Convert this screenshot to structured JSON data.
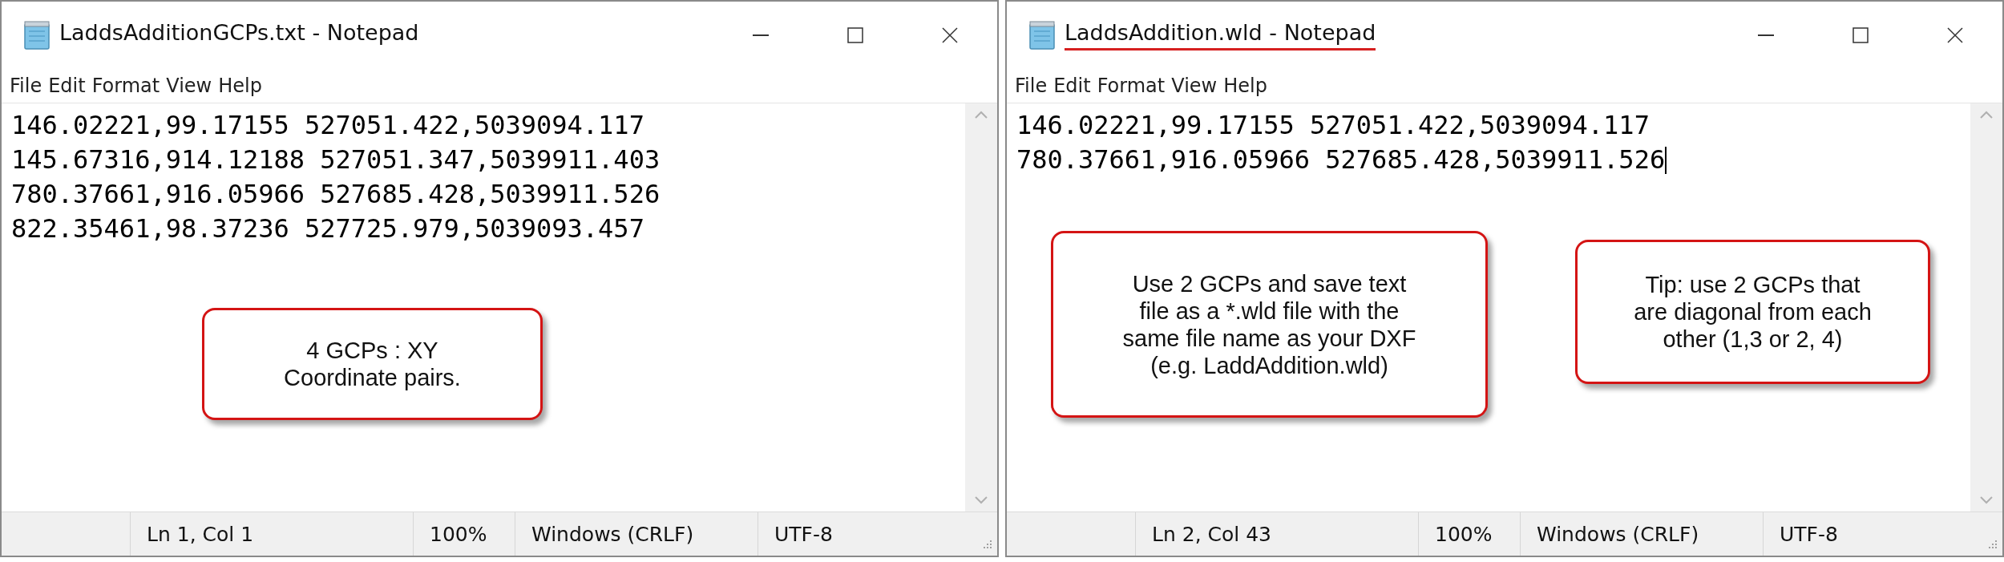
{
  "windows": [
    {
      "title": "LaddsAdditionGCPs.txt - Notepad",
      "title_underlined": false,
      "menu": [
        "File",
        "Edit",
        "Format",
        "View",
        "Help"
      ],
      "lines": [
        {
          "text": "146.02221,99.17155 527051.422,5039094.117",
          "caret": false
        },
        {
          "text": "145.67316,914.12188 527051.347,5039911.403",
          "caret": false
        },
        {
          "text": "780.37661,916.05966 527685.428,5039911.526",
          "caret": false
        },
        {
          "text": "822.35461,98.37236 527725.979,5039093.457",
          "caret": false
        }
      ],
      "callouts": [
        "4 GCPs : XY\nCoordinate pairs."
      ],
      "status_bar": [
        "Ln 1, Col 1",
        "100%",
        "Windows (CRLF)",
        "UTF-8"
      ]
    },
    {
      "title": "LaddsAddition.wld - Notepad",
      "title_underlined": true,
      "menu": [
        "File",
        "Edit",
        "Format",
        "View",
        "Help"
      ],
      "lines": [
        {
          "text": "146.02221,99.17155 527051.422,5039094.117",
          "caret": false
        },
        {
          "text": "780.37661,916.05966 527685.428,5039911.526",
          "caret": true
        }
      ],
      "callouts": [
        "Use 2 GCPs and save text\nfile as a *.wld file with the\nsame file name as your DXF\n(e.g. LaddAddition.wld)",
        "Tip: use 2 GCPs that\nare diagonal from each\nother (1,3 or 2, 4)"
      ],
      "status_bar": [
        "Ln 2, Col 43",
        "100%",
        "Windows (CRLF)",
        "UTF-8"
      ]
    }
  ]
}
